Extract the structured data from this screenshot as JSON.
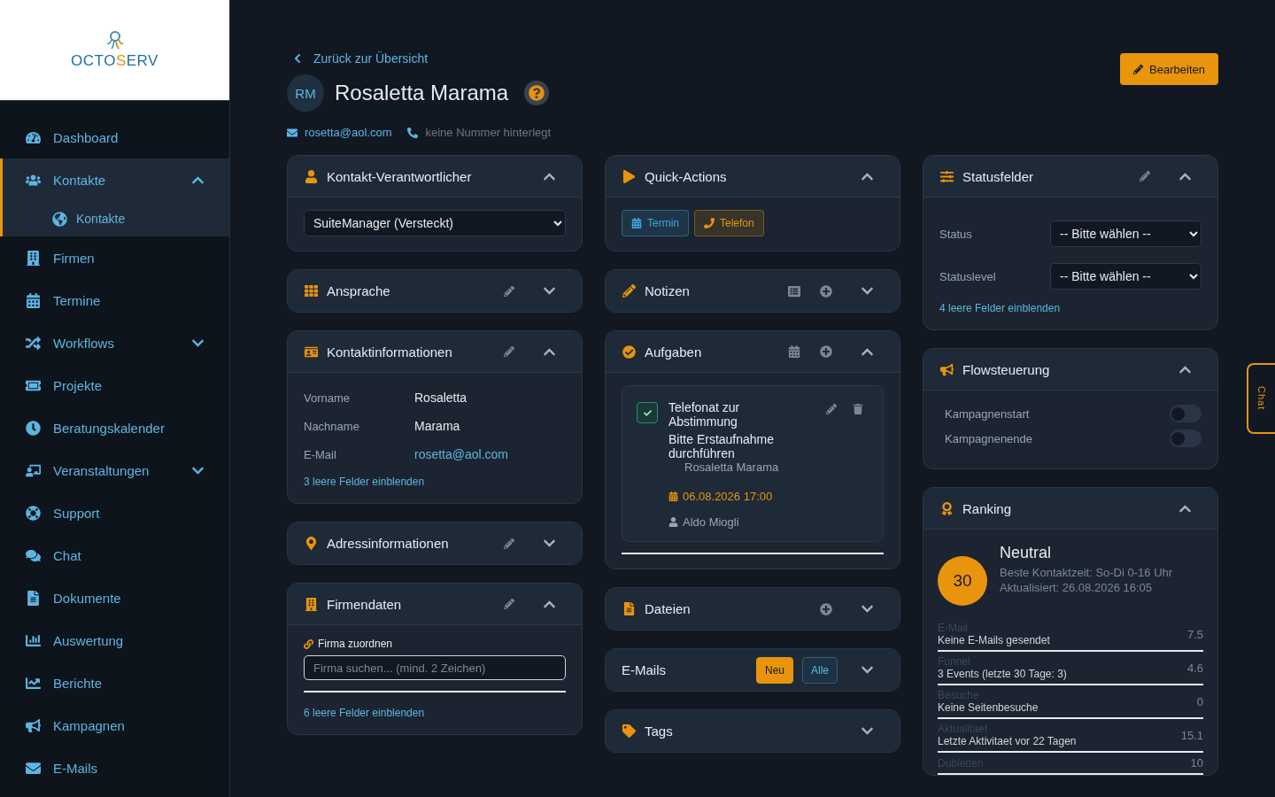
{
  "sidebar": {
    "logo": [
      {
        "text": "OCTO",
        "accent": false
      },
      {
        "text": "S",
        "accent": true
      },
      {
        "text": "ERV",
        "accent": false
      }
    ],
    "items": [
      {
        "label": "Dashboard",
        "selected": false
      },
      {
        "label": "Kontakte",
        "selected": true,
        "expanded": true,
        "children": [
          {
            "label": "Kontakte",
            "selected": true
          }
        ]
      },
      {
        "label": "Firmen",
        "selected": false
      },
      {
        "label": "Termine",
        "selected": false
      },
      {
        "label": "Workflows",
        "selected": false,
        "expanded": false
      },
      {
        "label": "Projekte",
        "selected": false
      },
      {
        "label": "Beratungskalender",
        "selected": false
      },
      {
        "label": "Veranstaltungen",
        "selected": false,
        "expanded": false
      },
      {
        "label": "Support",
        "selected": false
      },
      {
        "label": "Chat",
        "selected": false
      },
      {
        "label": "Dokumente",
        "selected": false
      },
      {
        "label": "Auswertung",
        "selected": false
      },
      {
        "label": "Berichte",
        "selected": false
      },
      {
        "label": "Kampagnen",
        "selected": false
      },
      {
        "label": "E-Mails",
        "selected": false
      }
    ]
  },
  "header": {
    "back_link": "Zurück zur Übersicht",
    "initials": "RM",
    "name": "Rosaletta Marama",
    "edit_button": "Bearbeiten",
    "email": "rosetta@aol.com",
    "phone": "keine Nummer hinterlegt"
  },
  "columns": [
    [
      {
        "kind": "select",
        "title": "Kontakt-Verantwortlicher",
        "expanded": true,
        "value": "SuiteManager (Versteckt)"
      },
      {
        "kind": "plain",
        "title": "Ansprache",
        "editable": true,
        "expanded": false
      },
      {
        "kind": "fields",
        "title": "Kontaktinformationen",
        "editable": true,
        "expanded": true,
        "fields": [
          {
            "label": "Vorname",
            "value": "Rosaletta",
            "link": false
          },
          {
            "label": "Nachname",
            "value": "Marama",
            "link": false
          },
          {
            "label": "E-Mail",
            "value": "rosetta@aol.com",
            "link": true
          }
        ],
        "more_link": "3 leere Felder einblenden"
      },
      {
        "kind": "plain",
        "title": "Adressinformationen",
        "editable": true,
        "expanded": false
      },
      {
        "kind": "company",
        "title": "Firmendaten",
        "editable": true,
        "expanded": true,
        "label": "Firma zuordnen",
        "placeholder": "Firma suchen... (mind. 2 Zeichen)",
        "more_link": "6 leere Felder einblenden"
      }
    ],
    [
      {
        "kind": "quick",
        "title": "Quick-Actions",
        "expanded": true,
        "actions": [
          {
            "label": "Termin",
            "color": "#3ba4e0"
          },
          {
            "label": "Telefon",
            "color": "#e8940c"
          }
        ]
      },
      {
        "kind": "notes",
        "title": "Notizen",
        "expanded": false
      },
      {
        "kind": "tasks",
        "title": "Aufgaben",
        "expanded": true,
        "tasks": [
          {
            "title": "Telefonat zur Abstimmung",
            "description": "Bitte Erstaufnahme durchführen",
            "contact": "Rosaletta Marama",
            "due": "06.08.2026 17:00",
            "assignee": "Aldo Miogli",
            "checked": true
          }
        ]
      },
      {
        "kind": "files",
        "title": "Dateien",
        "expanded": false
      },
      {
        "kind": "emails",
        "title": "E-Mails",
        "expanded": false,
        "filters": [
          {
            "label": "Neu",
            "selected": true
          },
          {
            "label": "Alle",
            "selected": false
          }
        ]
      },
      {
        "kind": "tags",
        "title": "Tags",
        "expanded": false
      }
    ],
    [
      {
        "kind": "status",
        "title": "Statusfelder",
        "editable": true,
        "expanded": true,
        "fields": [
          {
            "label": "Status",
            "value": "-- Bitte wählen --"
          },
          {
            "label": "Statuslevel",
            "value": "-- Bitte wählen --"
          }
        ],
        "more_link": "4 leere Felder einblenden"
      },
      {
        "kind": "flow",
        "title": "Flowsteuerung",
        "expanded": true,
        "toggles": [
          {
            "label": "Kampagnenstart",
            "on": false
          },
          {
            "label": "Kampagnenende",
            "on": false
          }
        ]
      },
      {
        "kind": "ranking",
        "title": "Ranking",
        "expanded": true,
        "score": "30",
        "rating": "Neutral",
        "details": [
          "Beste Kontaktzeit: So-Di 0-16 Uhr",
          "Aktualisiert: 26.08.2026 16:05"
        ],
        "factors": [
          {
            "label": "E-Mail",
            "description": "Keine E-Mails gesendet",
            "value": "7.5"
          },
          {
            "label": "Funnel",
            "description": "3 Events (letzte 30 Tage: 3)",
            "value": "4.6"
          },
          {
            "label": "Besuche",
            "description": "Keine Seitenbesuche",
            "value": "0"
          },
          {
            "label": "Aktualitaet",
            "description": "Letzte Aktivitaet vor 22 Tagen",
            "value": "15.1"
          },
          {
            "label": "Dubletten",
            "value": "10"
          }
        ]
      }
    ]
  ],
  "chat_tab": "Chat"
}
